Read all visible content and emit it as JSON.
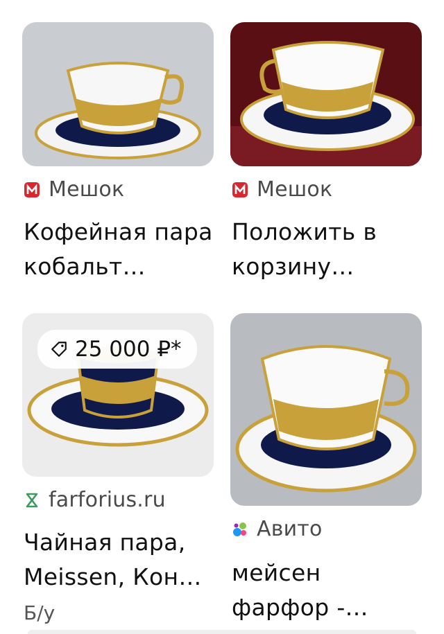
{
  "items": [
    {
      "source": {
        "name": "Мешок",
        "icon": "meshok-logo-icon"
      },
      "title_line1": "Кофейная пара",
      "title_line2": "кобальт…"
    },
    {
      "source": {
        "name": "Мешок",
        "icon": "meshok-logo-icon"
      },
      "title_line1": "Положить в",
      "title_line2": "корзину…"
    },
    {
      "source": {
        "name": "farforius.ru",
        "icon": "farforius-logo-icon"
      },
      "title_line1": "Чайная пара,",
      "title_line2": "Meissen, Кон…",
      "price": "25 000 ₽*",
      "condition": "Б/у"
    },
    {
      "source": {
        "name": "Авито",
        "icon": "avito-logo-icon"
      },
      "title_line1": "мейсен",
      "title_line2": "фарфор -…"
    }
  ],
  "colors": {
    "meshok_red": "#d7282f",
    "farforius_green": "#3c9a5f",
    "cobalt": "#0f1a4a",
    "gold": "#c9a13b"
  }
}
